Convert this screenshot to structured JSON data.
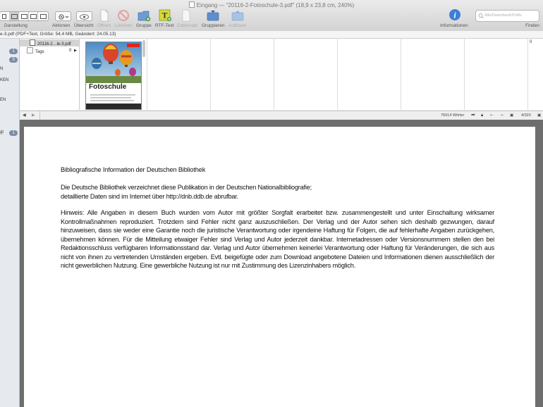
{
  "window": {
    "title": "Eingang — \"20116-2-Fotoschule-3.pdf\" (18,9 x 23,8 cm, 240%)"
  },
  "toolbar": {
    "darstellung": "Darstellung",
    "aktionen": "Aktionen",
    "uebersicht": "Übersicht",
    "oeffnen": "Öffnen",
    "loeschen": "Löschen",
    "gruppe": "Gruppe",
    "rtf_text": "RTF-Text",
    "datensatz": "Datensatz",
    "gruppieren": "Gruppieren",
    "aufloesen": "Auflösen",
    "informationen": "Informationen",
    "finden": "Finden",
    "search_placeholder": "Alle/Datenbank/Präfix"
  },
  "info_line": "e-3.pdf (PDF+Text, Größe: 54,4 MB, Geändert: 24.05.13)",
  "sidebar": {
    "badge1": "1",
    "badge2": "3",
    "label_n1": "N",
    "label_ken": "KEN",
    "label_en": "EN",
    "label_gt": "gt",
    "badge3": "1"
  },
  "list": {
    "selected_item": "20116-2…le-3.pdf",
    "tags_label": "Tags",
    "tags_count": "0"
  },
  "thumbnail": {
    "cover_title": "Fotoschule",
    "strip_count": "0"
  },
  "statusbar": {
    "word_count": "76014 Wörter",
    "page_indicator": "4/320"
  },
  "document": {
    "heading": "Bibliografische Information der Deutschen Bibliothek",
    "para1": "Die Deutsche Bibliothek verzeichnet diese Publikation in der Deutschen Nationalbibliografie; detaillierte Daten sind im Internet über http://dnb.ddb.de abrufbar.",
    "para2": "Hinweis: Alle Angaben in diesem Buch wurden vom Autor mit größter Sorgfalt erarbeitet bzw. zusammengestellt und unter Einschaltung wirksamer Kontrollmaßnahmen reproduziert. Trotzdem sind Fehler nicht ganz auszuschließen. Der Verlag und der Autor sehen sich deshalb gezwungen, darauf hinzuweisen, dass sie weder eine Garantie noch die juristische Verantwortung oder irgendeine Haftung für Folgen, die auf fehlerhafte Angaben zurückgehen, übernehmen können. Für die Mitteilung etwaiger Fehler sind Verlag und Autor jederzeit dankbar. Internetadressen oder Versionsnummern stellen den bei Redaktionsschluss verfügbaren Informationsstand dar. Verlag und Autor übernehmen keinerlei Verantwortung oder Haftung für Veränderungen, die sich aus nicht von ihnen zu vertretenden Umständen ergeben. Evtl. beigefügte oder zum Download angebotene Dateien und Informationen dienen ausschließlich der nicht gewerblichen Nutzung. Eine gewerbliche Nutzung ist nur mit Zustimmung des Lizenzinhabers möglich."
  },
  "colors": {
    "badge": "#7d8ca6",
    "info_button": "#3d7fd8",
    "delete_icon": "#d9534f",
    "group_icon": "#5d8fcf",
    "rtf_icon": "#c8cf2a",
    "doc_background": "#6e6e6e"
  },
  "icons": {
    "view_modes": [
      "view-list-icon",
      "view-columns-icon",
      "view-split-icon",
      "view-split-horizontal-icon",
      "view-preview-icon"
    ],
    "actions": "gear-icon",
    "overview": "eye-icon",
    "open": "document-icon",
    "delete": "no-entry-icon",
    "group": "folder-plus-icon",
    "rtf": "rtf-text-icon",
    "record": "record-icon",
    "grouping": "folder-tray-icon",
    "dissolve": "folder-tray-icon",
    "info": "info-icon",
    "search": "magnifier-icon"
  }
}
